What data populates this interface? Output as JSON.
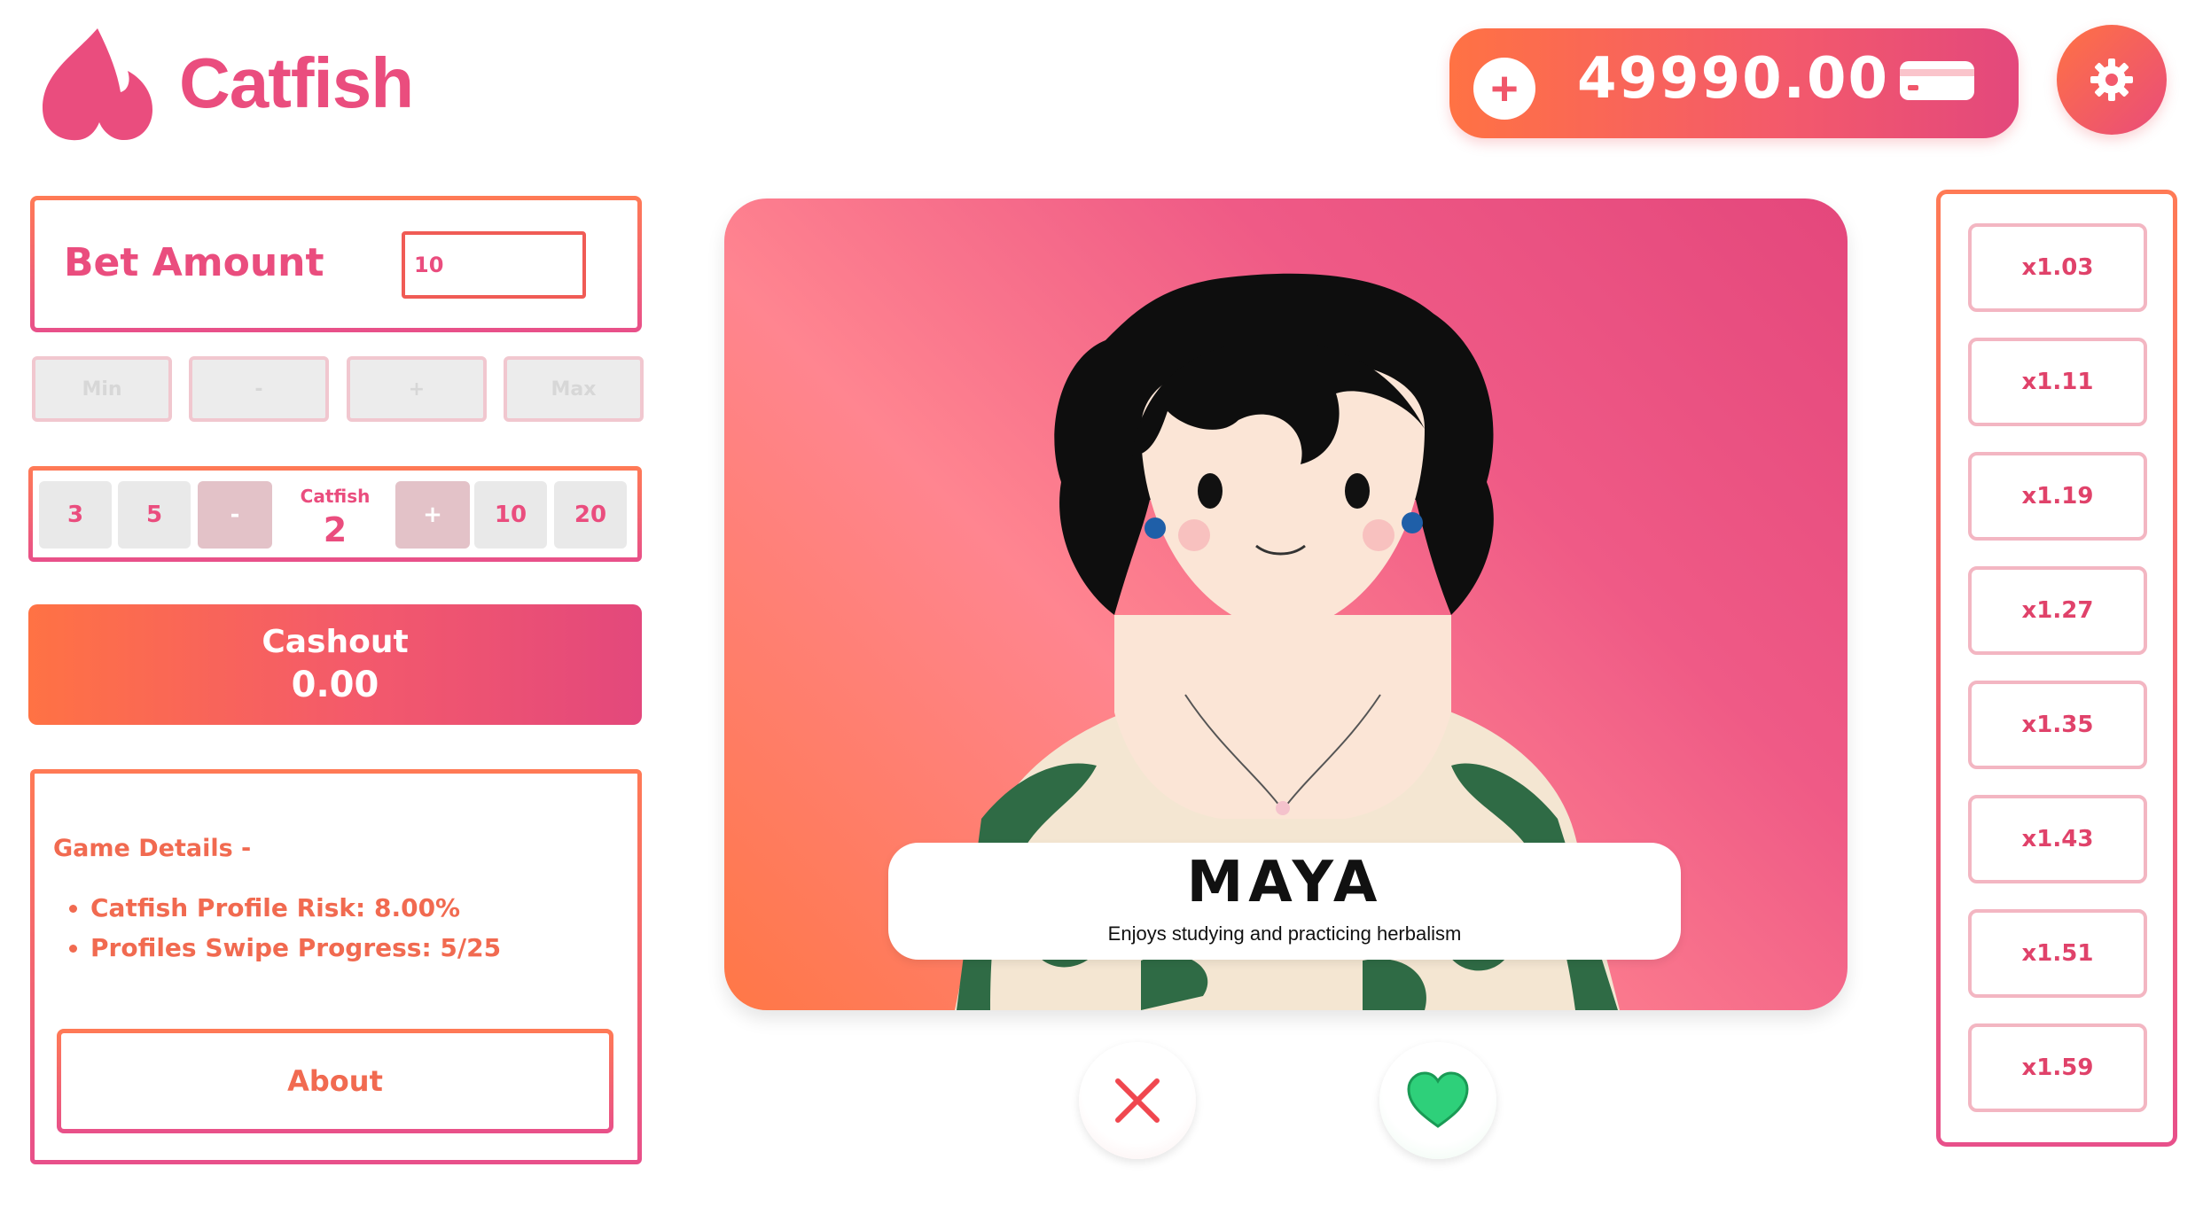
{
  "app": {
    "name": "Catfish"
  },
  "header": {
    "balance": "49990.00",
    "add_symbol": "+"
  },
  "bet": {
    "label": "Bet Amount",
    "value": "10",
    "buttons": [
      "Min",
      "-",
      "+",
      "Max"
    ]
  },
  "catfish": {
    "label": "Catfish",
    "value": "2",
    "left_options": [
      "3",
      "5"
    ],
    "right_options": [
      "10",
      "20"
    ],
    "decrement": "-",
    "increment": "+"
  },
  "cashout": {
    "label": "Cashout",
    "value": "0.00"
  },
  "details": {
    "title": "Game Details -",
    "items": [
      "Catfish Profile Risk:  8.00%",
      "Profiles Swipe Progress: 5/25"
    ],
    "about_label": "About"
  },
  "profile": {
    "name": "MAYA",
    "bio": "Enjoys studying and practicing herbalism"
  },
  "multipliers": [
    "x1.03",
    "x1.11",
    "x1.19",
    "x1.27",
    "x1.35",
    "x1.43",
    "x1.51",
    "x1.59"
  ],
  "colors": {
    "brand_pink": "#ea4d7e",
    "brand_orange": "#ff7244",
    "like_green": "#2ed07a",
    "reject_red": "#f0474f"
  },
  "icons": {
    "logo": "flame-icon",
    "wallet": "wallet-icon",
    "settings": "gear-icon",
    "reject": "close-icon",
    "like": "heart-icon"
  }
}
